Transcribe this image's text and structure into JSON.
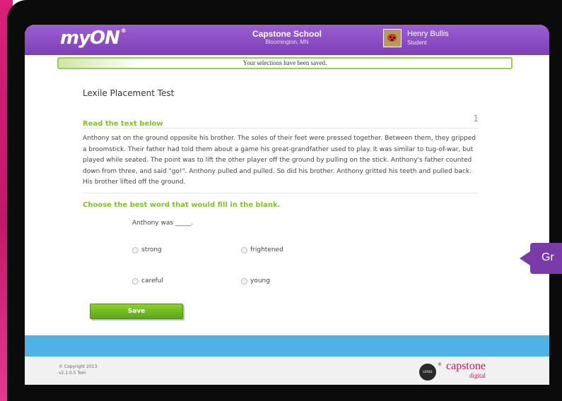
{
  "header": {
    "logo": "myON",
    "logo_mark": "®",
    "school_name": "Capstone School",
    "school_location": "Bloomington, MN",
    "user_name": "Henry Bullis",
    "user_role": "Student",
    "avatar_icon": "ladybug-avatar-icon"
  },
  "banner": {
    "saved_message": "Your selections have been saved."
  },
  "test": {
    "title": "Lexile Placement Test",
    "section_label": "Read the text below",
    "question_number": "1",
    "passage": "Anthony sat on the ground opposite his brother. The soles of their feet were pressed together. Between them, they gripped a broomstick. Their father had told them about a game his great-grandfather used to play. It was similar to tug-of-war, but played while seated. The point was to lift the other player off the ground by pulling on the stick. Anthony's father counted down from three, and said \"go!\". Anthony pulled and pulled. So did his brother. Anthony gritted his teeth and pulled back. His brother lifted off the ground.",
    "question": "Choose the best word that would fill in the blank.",
    "stem": "Anthony was _____.",
    "options": [
      "strong",
      "frightened",
      "careful",
      "young"
    ],
    "save_label": "Save"
  },
  "footer": {
    "copyright": "© Copyright 2013",
    "version": "v2.1.0.5 Tom",
    "lexile_logo": "LEXILE",
    "lexile_mark": "®",
    "capstone_brand": "capstone",
    "capstone_sub": "digital"
  },
  "tooltip": {
    "text": "Gr"
  },
  "colors": {
    "header_purple": "#8a4cc4",
    "accent_green": "#7fbf2f",
    "footer_blue": "#4fb2e6",
    "capstone_red": "#b01f5a"
  }
}
